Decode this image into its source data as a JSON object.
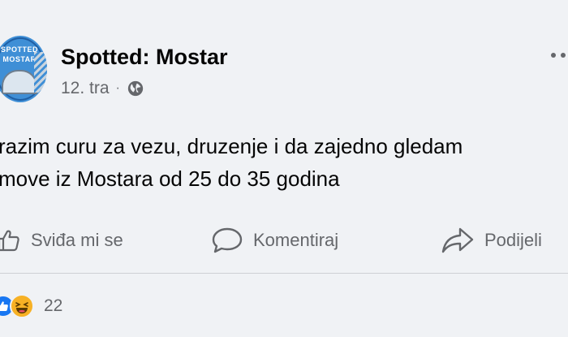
{
  "post": {
    "page_name": "Spotted: Mostar",
    "date": "12. tra",
    "separator": "·",
    "privacy_icon": "globe-icon",
    "avatar": {
      "logo_line1": "SPOTTED",
      "logo_line2": "MOSTAR"
    },
    "text": "razim curu za vezu, druzenje i da zajedno gledam\nmove iz Mostara od 25 do 35 godina"
  },
  "actions": {
    "like_label": "Sviđa mi se",
    "comment_label": "Komentiraj",
    "share_label": "Podijeli"
  },
  "reactions": {
    "icons": [
      "like-reaction-icon",
      "haha-reaction-icon"
    ],
    "count": "22"
  },
  "colors": {
    "background": "#f0f2f5",
    "secondary_text": "#65676b",
    "primary_text": "#050505",
    "like_blue": "#1877f2",
    "haha_yellow": "#f7b125"
  }
}
